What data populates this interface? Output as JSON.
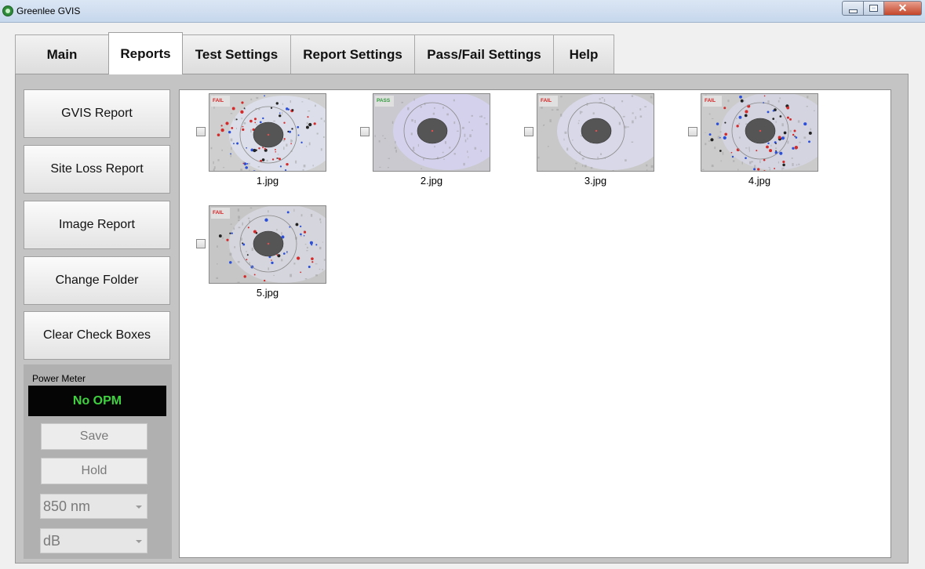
{
  "window": {
    "title": "Greenlee GVIS",
    "minimize_glyph": "",
    "maximize_glyph": "",
    "close_glyph": "✕"
  },
  "tabs": [
    {
      "label": "Main",
      "active": false
    },
    {
      "label": "Reports",
      "active": true
    },
    {
      "label": "Test Settings",
      "active": false
    },
    {
      "label": "Report Settings",
      "active": false
    },
    {
      "label": "Pass/Fail Settings",
      "active": false
    },
    {
      "label": "Help",
      "active": false
    }
  ],
  "reports_panel": {
    "buttons": [
      {
        "label": "GVIS Report"
      },
      {
        "label": "Site Loss Report"
      },
      {
        "label": "Image Report"
      },
      {
        "label": "Change Folder"
      },
      {
        "label": "Clear Check Boxes"
      }
    ]
  },
  "power_meter": {
    "label": "Power Meter",
    "display": "No OPM",
    "display_color": "#3fd13f",
    "save_label": "Save",
    "hold_label": "Hold",
    "wavelength": "850 nm",
    "unit": "dB"
  },
  "images": [
    {
      "filename": "1.jpg",
      "status": "FAIL",
      "checked": false
    },
    {
      "filename": "2.jpg",
      "status": "PASS",
      "checked": false
    },
    {
      "filename": "3.jpg",
      "status": "FAIL",
      "checked": false
    },
    {
      "filename": "4.jpg",
      "status": "FAIL",
      "checked": false
    },
    {
      "filename": "5.jpg",
      "status": "FAIL",
      "checked": false
    }
  ],
  "colors": {
    "fail": "#d62020",
    "pass": "#2e9b3a"
  }
}
